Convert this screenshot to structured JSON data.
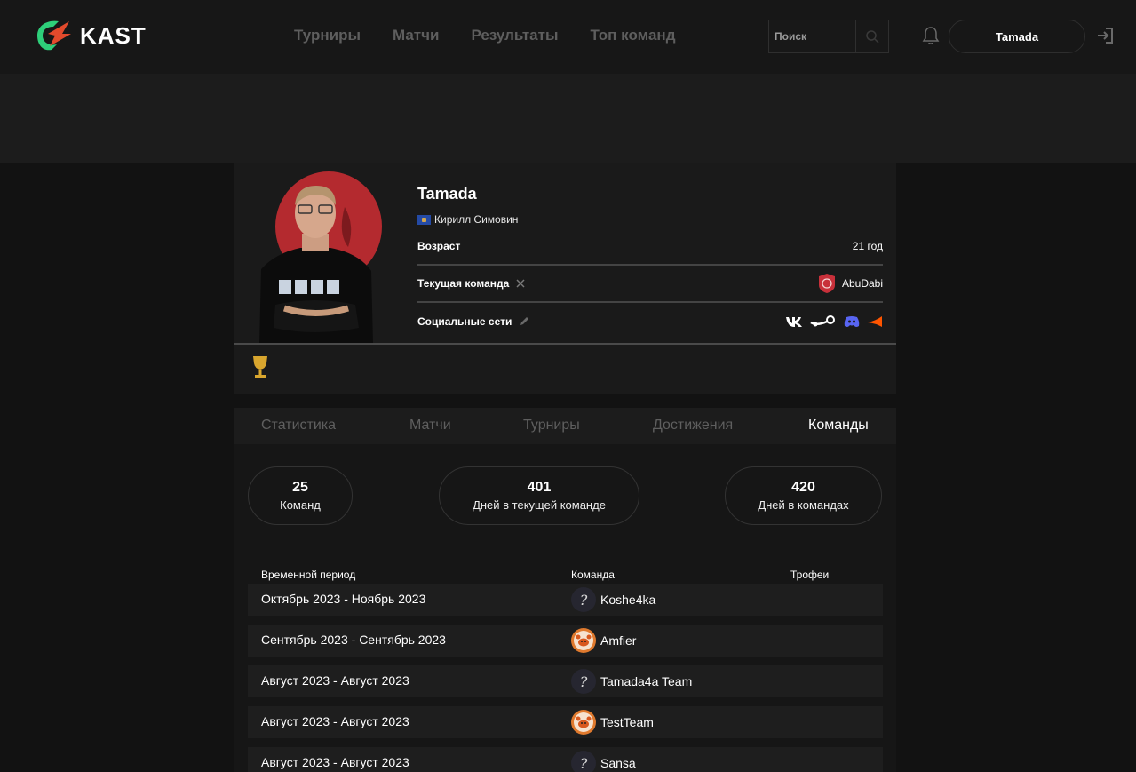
{
  "header": {
    "brand": "KAST",
    "nav": [
      "Турниры",
      "Матчи",
      "Результаты",
      "Топ команд"
    ],
    "search_placeholder": "Поиск",
    "username": "Tamada"
  },
  "profile": {
    "nickname": "Tamada",
    "real_name": "Кирилл Симовин",
    "age_label": "Возраст",
    "age_value": "21 год",
    "team_label": "Текущая команда",
    "team_value": "AbuDabi",
    "social_label": "Социальные сети",
    "socials": [
      "vk-icon",
      "steam-icon",
      "discord-icon",
      "faceit-icon"
    ]
  },
  "tabs": [
    "Статистика",
    "Матчи",
    "Турниры",
    "Достижения",
    "Команды"
  ],
  "active_tab": "Команды",
  "stats": [
    {
      "value": "25",
      "caption": "Команд"
    },
    {
      "value": "401",
      "caption": "Дней в текущей команде"
    },
    {
      "value": "420",
      "caption": "Дней в командах"
    }
  ],
  "table": {
    "headers": [
      "Временной период",
      "Команда",
      "Трофеи"
    ],
    "rows": [
      {
        "period": "Октябрь 2023 - Ноябрь 2023",
        "team": "Koshe4ka",
        "logo": "question"
      },
      {
        "period": "Сентябрь 2023 - Сентябрь 2023",
        "team": "Amfier",
        "logo": "crab"
      },
      {
        "period": "Август 2023 - Август 2023",
        "team": "Tamada4a Team",
        "logo": "question"
      },
      {
        "period": "Август 2023 - Август 2023",
        "team": "TestTeam",
        "logo": "crab"
      },
      {
        "period": "Август 2023 - Август 2023",
        "team": "Sansa",
        "logo": "question"
      }
    ]
  },
  "colors": {
    "accent_green": "#2ecf7a",
    "accent_red": "#d93a2f",
    "background": "#121212"
  }
}
